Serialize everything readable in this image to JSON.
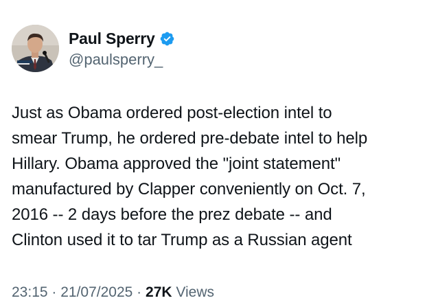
{
  "author": {
    "display_name": "Paul Sperry",
    "handle": "@paulsperry_",
    "verified": true,
    "avatar_icon": "profile-photo",
    "verified_icon": "verified-badge-icon",
    "badge_color": "#1d9bf0"
  },
  "tweet": {
    "text": "Just as Obama ordered post-election intel to\nsmear Trump, he ordered pre-debate intel to help\nHillary. Obama approved the \"joint statement\"\nmanufactured by Clapper conveniently on Oct. 7,\n2016 -- 2 days before the prez debate -- and\nClinton used it to tar Trump as a Russian agent"
  },
  "meta": {
    "time": "23:15",
    "separator1": " · ",
    "date": "21/07/2025",
    "separator2": " · ",
    "views_count": "27K",
    "views_label": " Views"
  },
  "colors": {
    "text_primary": "#0f1419",
    "text_secondary": "#536471",
    "accent": "#1d9bf0"
  }
}
